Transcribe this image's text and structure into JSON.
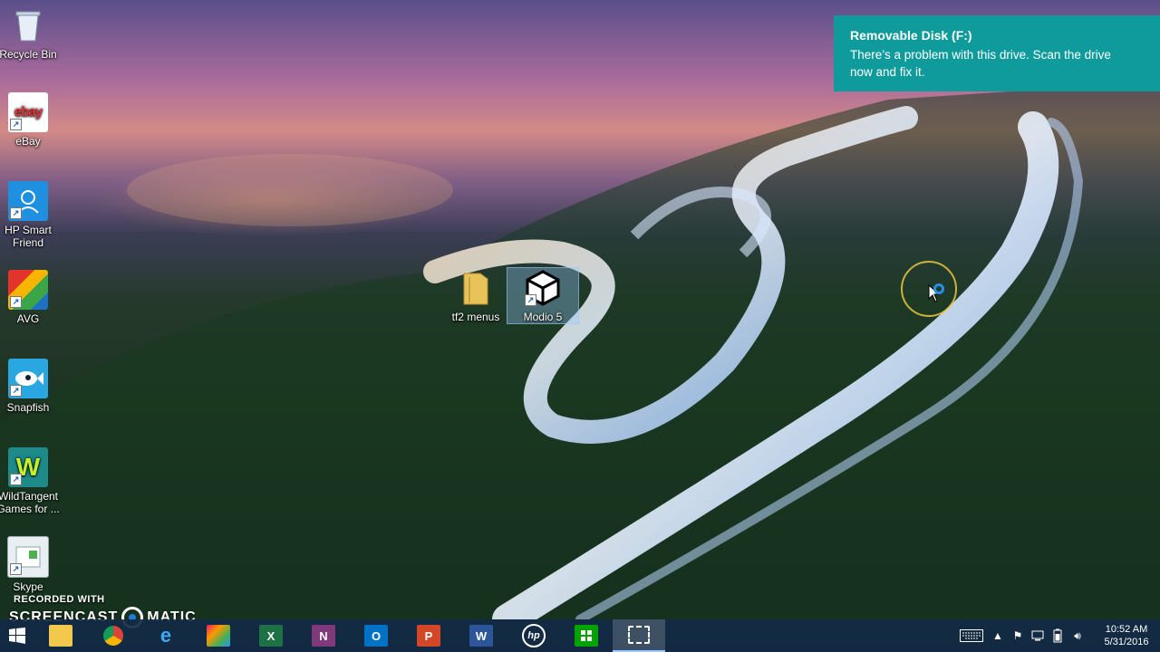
{
  "desktop_icons": [
    {
      "label": "Recycle Bin",
      "icon": "recycle-bin-icon"
    },
    {
      "label": "eBay",
      "icon": "ebay-icon"
    },
    {
      "label": "HP Smart Friend",
      "icon": "hp-smart-friend-icon"
    },
    {
      "label": "AVG",
      "icon": "avg-icon"
    },
    {
      "label": "Snapfish",
      "icon": "snapfish-icon"
    },
    {
      "label": "WildTangent Games for ...",
      "icon": "wildtangent-icon"
    },
    {
      "label": "Skype",
      "icon": "skype-icon"
    },
    {
      "label": "tf2 menus",
      "icon": "folder-icon"
    },
    {
      "label": "Modio 5",
      "icon": "modio-icon"
    }
  ],
  "notification": {
    "title": "Removable Disk (F:)",
    "body": "There’s a problem with this drive.  Scan the drive now and fix it."
  },
  "watermark": {
    "line1": "RECORDED WITH",
    "line2a": "SCREENCAST",
    "line2b": "MATIC"
  },
  "taskbar": {
    "apps": [
      "start-icon",
      "file-explorer-icon",
      "chrome-icon",
      "internet-explorer-icon",
      "photo-app-icon",
      "excel-icon",
      "onenote-icon",
      "outlook-icon",
      "powerpoint-icon",
      "word-icon",
      "hp-icon",
      "store-icon",
      "snipping-tool-icon"
    ],
    "excel_letter": "X",
    "onenote_letter": "N",
    "outlook_letter": "O",
    "powerpoint_letter": "P",
    "word_letter": "W",
    "hp_letters": "hp",
    "ebay_letters": "ebay",
    "wildtangent_letter": "W"
  },
  "tray": {
    "time": "10:52 AM",
    "date": "5/31/2016"
  },
  "colors": {
    "notification_bg": "#0f9b9b",
    "taskbar_bg": "#142a46"
  }
}
